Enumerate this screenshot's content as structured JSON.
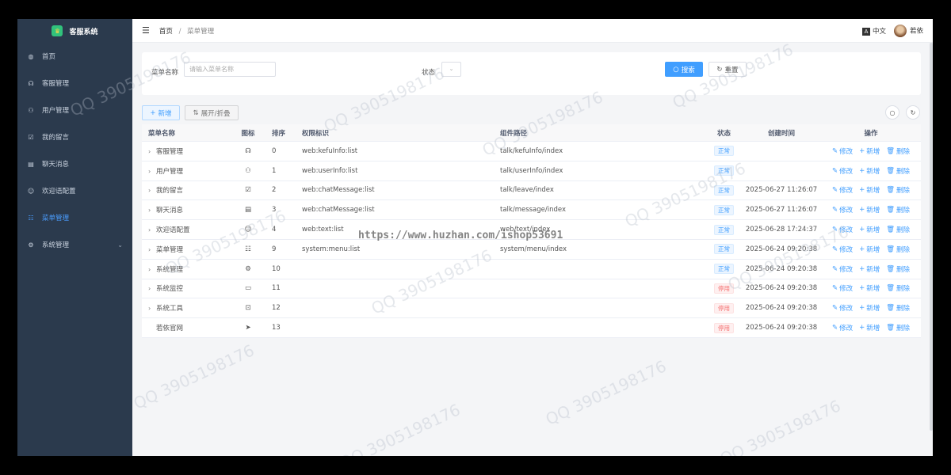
{
  "app": {
    "title": "客服系统"
  },
  "sidebar": {
    "items": [
      {
        "label": "首页",
        "icon": "dashboard-icon"
      },
      {
        "label": "客服管理",
        "icon": "headset-icon"
      },
      {
        "label": "用户管理",
        "icon": "users-icon"
      },
      {
        "label": "我的留言",
        "icon": "checkbox-icon"
      },
      {
        "label": "聊天消息",
        "icon": "message-icon"
      },
      {
        "label": "欢迎语配置",
        "icon": "smile-icon"
      },
      {
        "label": "菜单管理",
        "icon": "menu-tree-icon",
        "active": true
      },
      {
        "label": "系统管理",
        "icon": "gear-icon",
        "expandable": true
      }
    ]
  },
  "topbar": {
    "breadcrumb": [
      "首页",
      "菜单管理"
    ],
    "language": "中文",
    "user": "若依"
  },
  "search": {
    "menu_name_label": "菜单名称",
    "menu_name_placeholder": "请输入菜单名称",
    "status_label": "状态",
    "search_button": "搜索",
    "reset_button": "重置"
  },
  "toolbar": {
    "add_button": "新增",
    "expand_button": "展开/折叠"
  },
  "table": {
    "headers": [
      "菜单名称",
      "图标",
      "排序",
      "权限标识",
      "组件路径",
      "状态",
      "创建时间",
      "操作"
    ],
    "ops": {
      "edit": "修改",
      "add": "新增",
      "delete": "删除"
    },
    "rows": [
      {
        "name": "客服管理",
        "icon": "headset-icon",
        "order": "0",
        "perm": "web:kefuInfo:list",
        "path": "talk/kefuInfo/index",
        "status": "正常",
        "status_type": "ok",
        "time": "",
        "expandable": true
      },
      {
        "name": "用户管理",
        "icon": "users-icon",
        "order": "1",
        "perm": "web:userInfo:list",
        "path": "talk/userInfo/index",
        "status": "正常",
        "status_type": "ok",
        "time": "",
        "expandable": true
      },
      {
        "name": "我的留言",
        "icon": "checkbox-icon",
        "order": "2",
        "perm": "web:chatMessage:list",
        "path": "talk/leave/index",
        "status": "正常",
        "status_type": "ok",
        "time": "2025-06-27 11:26:07",
        "expandable": true
      },
      {
        "name": "聊天消息",
        "icon": "message-icon",
        "order": "3",
        "perm": "web:chatMessage:list",
        "path": "talk/message/index",
        "status": "正常",
        "status_type": "ok",
        "time": "2025-06-27 11:26:07",
        "expandable": true
      },
      {
        "name": "欢迎语配置",
        "icon": "smile-icon",
        "order": "4",
        "perm": "web:text:list",
        "path": "web/text/index",
        "status": "正常",
        "status_type": "ok",
        "time": "2025-06-28 17:24:37",
        "expandable": true
      },
      {
        "name": "菜单管理",
        "icon": "menu-tree-icon",
        "order": "9",
        "perm": "system:menu:list",
        "path": "system/menu/index",
        "status": "正常",
        "status_type": "ok",
        "time": "2025-06-24 09:20:38",
        "expandable": true
      },
      {
        "name": "系统管理",
        "icon": "gear-icon",
        "order": "10",
        "perm": "",
        "path": "",
        "status": "正常",
        "status_type": "ok",
        "time": "2025-06-24 09:20:38",
        "expandable": true
      },
      {
        "name": "系统监控",
        "icon": "monitor-icon",
        "order": "11",
        "perm": "",
        "path": "",
        "status": "停用",
        "status_type": "stop",
        "time": "2025-06-24 09:20:38",
        "expandable": true
      },
      {
        "name": "系统工具",
        "icon": "toolbox-icon",
        "order": "12",
        "perm": "",
        "path": "",
        "status": "停用",
        "status_type": "stop",
        "time": "2025-06-24 09:20:38",
        "expandable": true
      },
      {
        "name": "若依官网",
        "icon": "send-icon",
        "order": "13",
        "perm": "",
        "path": "",
        "status": "停用",
        "status_type": "stop",
        "time": "2025-06-24 09:20:38",
        "expandable": false
      }
    ]
  },
  "watermarks": {
    "qq": "QQ 3905198176",
    "url": "https://www.huzhan.com/ishop53691"
  }
}
